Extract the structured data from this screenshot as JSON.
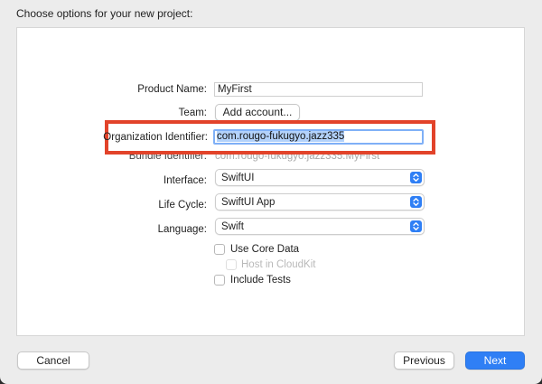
{
  "window": {
    "title": "Choose options for your new project:"
  },
  "form": {
    "product_name": {
      "label": "Product Name:",
      "value": "MyFirst"
    },
    "team": {
      "label": "Team:",
      "button_label": "Add account..."
    },
    "organization_identifier": {
      "label": "Organization Identifier:",
      "value": "com.rougo-fukugyo.jazz335"
    },
    "bundle_identifier": {
      "label": "Bundle Identifier:",
      "value": "com.rougo-fukugyo.jazz335.MyFirst"
    },
    "interface": {
      "label": "Interface:",
      "value": "SwiftUI",
      "icon": "popup-arrows-icon"
    },
    "life_cycle": {
      "label": "Life Cycle:",
      "value": "SwiftUI App",
      "icon": "popup-arrows-icon"
    },
    "language": {
      "label": "Language:",
      "value": "Swift",
      "icon": "popup-arrows-icon"
    },
    "use_core_data": {
      "label": "Use Core Data",
      "checked": false
    },
    "host_in_cloudkit": {
      "label": "Host in CloudKit",
      "checked": false,
      "enabled": false
    },
    "include_tests": {
      "label": "Include Tests",
      "checked": false
    }
  },
  "footer": {
    "cancel_label": "Cancel",
    "previous_label": "Previous",
    "next_label": "Next"
  },
  "colors": {
    "accent": "#2f7ff5",
    "highlight_annotation": "#e2432a",
    "selection": "#b3d2fb"
  }
}
